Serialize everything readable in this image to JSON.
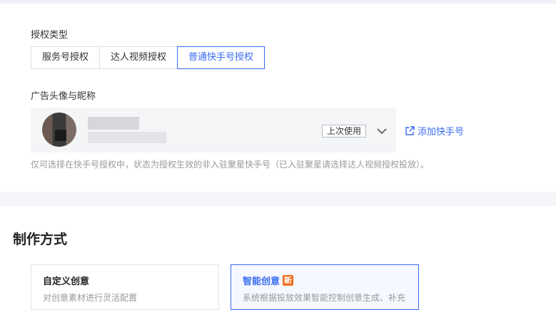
{
  "auth": {
    "label": "授权类型",
    "options": [
      "服务号授权",
      "达人视频授权",
      "普通快手号授权"
    ],
    "selected_index": 2
  },
  "account": {
    "label": "广告头像与昵称",
    "last_used_badge": "上次使用",
    "add_link": "添加快手号",
    "hint": "仅可选择在快手号授权中，状态为授权生效的非入驻聚星快手号（已入驻聚星请选择达人视频授权投放）。"
  },
  "production": {
    "title": "制作方式",
    "modes": [
      {
        "title": "自定义创意",
        "desc": "对创意素材进行灵活配置"
      },
      {
        "title": "智能创意",
        "badge": "新",
        "desc": "系统根据投放效果智能控制创意生成、补充"
      }
    ],
    "selected_index": 1
  },
  "colors": {
    "accent": "#3a6cf0",
    "new_badge": "#f26b1d"
  }
}
